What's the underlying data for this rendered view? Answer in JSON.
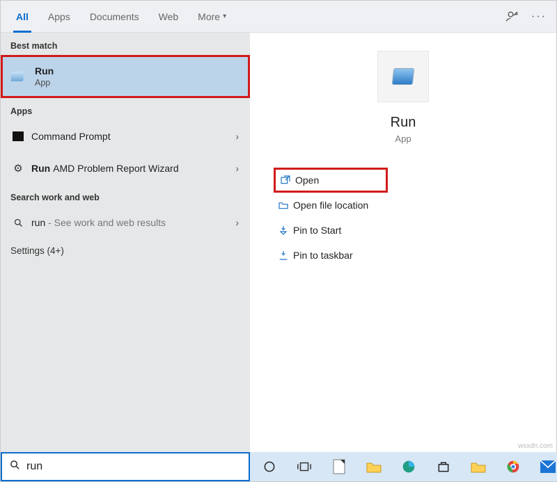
{
  "tabs": {
    "items": [
      {
        "label": "All",
        "active": true
      },
      {
        "label": "Apps",
        "active": false
      },
      {
        "label": "Documents",
        "active": false
      },
      {
        "label": "Web",
        "active": false
      },
      {
        "label": "More",
        "active": false,
        "caret": true
      }
    ]
  },
  "left": {
    "best_match_header": "Best match",
    "best_match": {
      "title": "Run",
      "subtitle": "App"
    },
    "apps_header": "Apps",
    "apps": [
      {
        "icon": "terminal",
        "prefix": "",
        "name": "Command Prompt"
      },
      {
        "icon": "gear",
        "prefix": "Run ",
        "name": "AMD Problem Report Wizard"
      }
    ],
    "web_header": "Search work and web",
    "web": {
      "query": "run",
      "suffix": " - See work and web results"
    },
    "settings": {
      "label": "Settings (4+)"
    }
  },
  "preview": {
    "title": "Run",
    "subtitle": "App",
    "actions": [
      {
        "icon": "open",
        "label": "Open",
        "highlight": true
      },
      {
        "icon": "folder",
        "label": "Open file location",
        "highlight": false
      },
      {
        "icon": "pin-start",
        "label": "Pin to Start",
        "highlight": false
      },
      {
        "icon": "pin-task",
        "label": "Pin to taskbar",
        "highlight": false
      }
    ]
  },
  "search": {
    "value": "run"
  },
  "taskbar_icons": [
    "cortana-circle",
    "task-view",
    "libreoffice",
    "file-explorer",
    "edge",
    "microsoft-store",
    "file-explorer-alt",
    "chrome",
    "mail"
  ],
  "watermark": "wsxdn.com"
}
